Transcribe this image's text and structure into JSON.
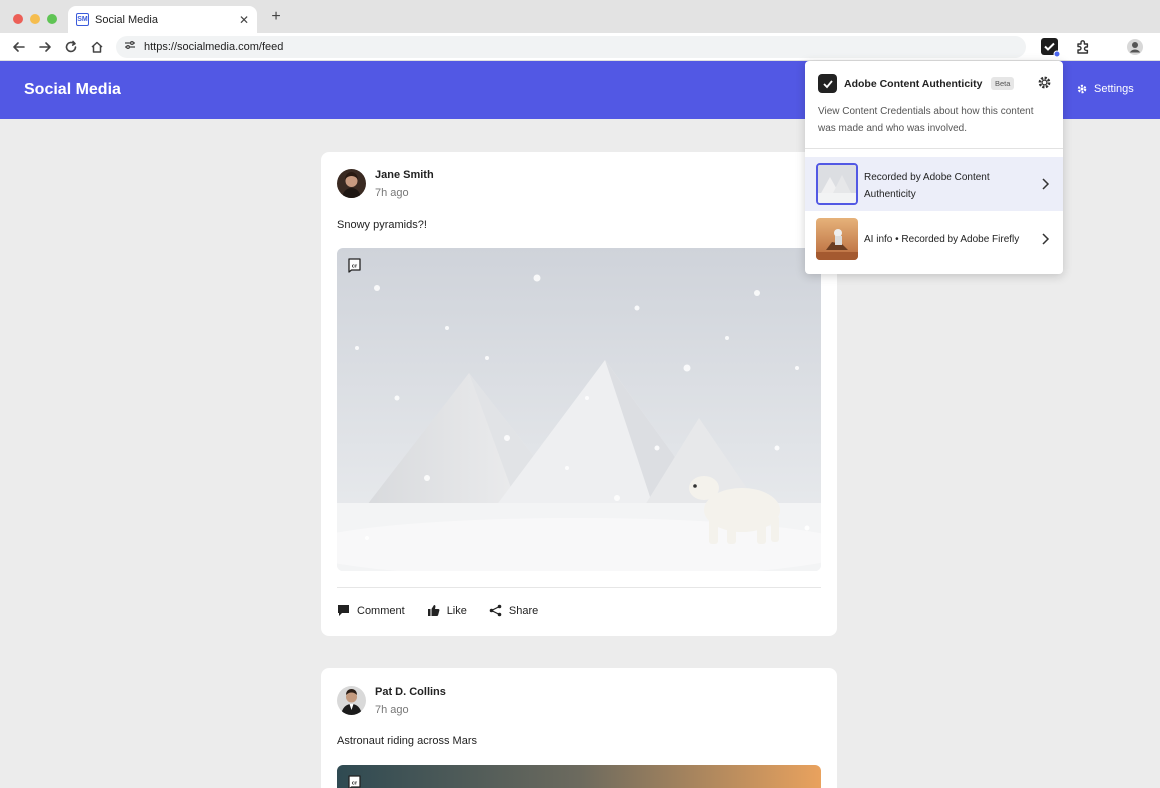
{
  "browser": {
    "tab_title": "Social Media",
    "tab_favicon": "SM",
    "url": "https://socialmedia.com/feed",
    "icons": [
      "back-arrow-icon",
      "forward-arrow-icon",
      "reload-icon",
      "home-icon",
      "site-settings-icon",
      "content-authenticity-extension-icon",
      "extensions-puzzle-icon",
      "profile-icon"
    ]
  },
  "app": {
    "title": "Social Media",
    "settings_label": "Settings",
    "accent": "#5258e4"
  },
  "posts": [
    {
      "author": "Jane Smith",
      "time": "7h ago",
      "caption": "Snowy pyramids?!",
      "actions": {
        "comment": "Comment",
        "like": "Like",
        "share": "Share"
      }
    },
    {
      "author": "Pat D. Collins",
      "time": "7h ago",
      "caption": "Astronaut riding across Mars"
    }
  ],
  "popup": {
    "title": "Adobe Content Authenticity",
    "badge": "Beta",
    "description": "View Content Credentials about how this content was made and who was involved.",
    "items": [
      {
        "label": "Recorded by Adobe Content Authenticity"
      },
      {
        "label": "AI info •  Recorded by Adobe Firefly"
      }
    ]
  }
}
